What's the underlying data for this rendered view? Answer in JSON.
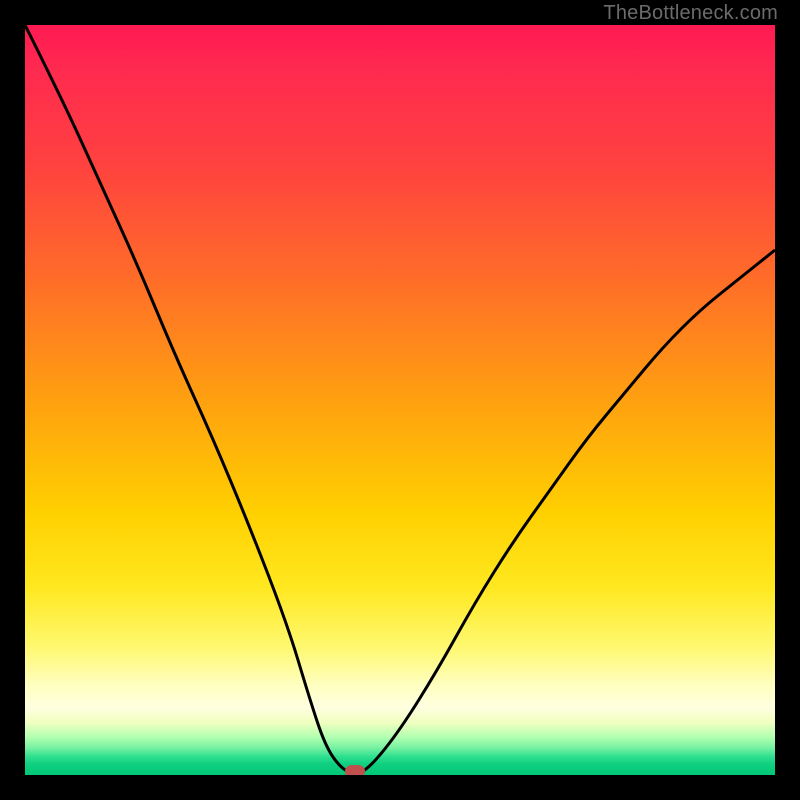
{
  "watermark": "TheBottleneck.com",
  "colors": {
    "frame": "#000000",
    "curve": "#000000",
    "marker": "#c0504d"
  },
  "chart_data": {
    "type": "line",
    "title": "",
    "xlabel": "",
    "ylabel": "",
    "xlim": [
      0,
      100
    ],
    "ylim": [
      0,
      100
    ],
    "series": [
      {
        "name": "bottleneck-curve",
        "x": [
          0,
          5,
          10,
          15,
          20,
          25,
          30,
          35,
          38,
          40,
          42,
          44,
          46,
          50,
          55,
          60,
          65,
          70,
          75,
          80,
          85,
          90,
          95,
          100
        ],
        "y": [
          100,
          90,
          79,
          68,
          56,
          45,
          33,
          20,
          10,
          4,
          1,
          0,
          1,
          6,
          14,
          23,
          31,
          38,
          45,
          51,
          57,
          62,
          66,
          70
        ]
      }
    ],
    "annotations": [
      {
        "name": "optimal-point",
        "x": 44,
        "y": 0
      }
    ],
    "background": {
      "type": "vertical-gradient",
      "stops": [
        {
          "pos": 0.0,
          "color": "#ff1a52"
        },
        {
          "pos": 0.5,
          "color": "#ffa010"
        },
        {
          "pos": 0.88,
          "color": "#ffffc0"
        },
        {
          "pos": 1.0,
          "color": "#00c878"
        }
      ]
    }
  }
}
